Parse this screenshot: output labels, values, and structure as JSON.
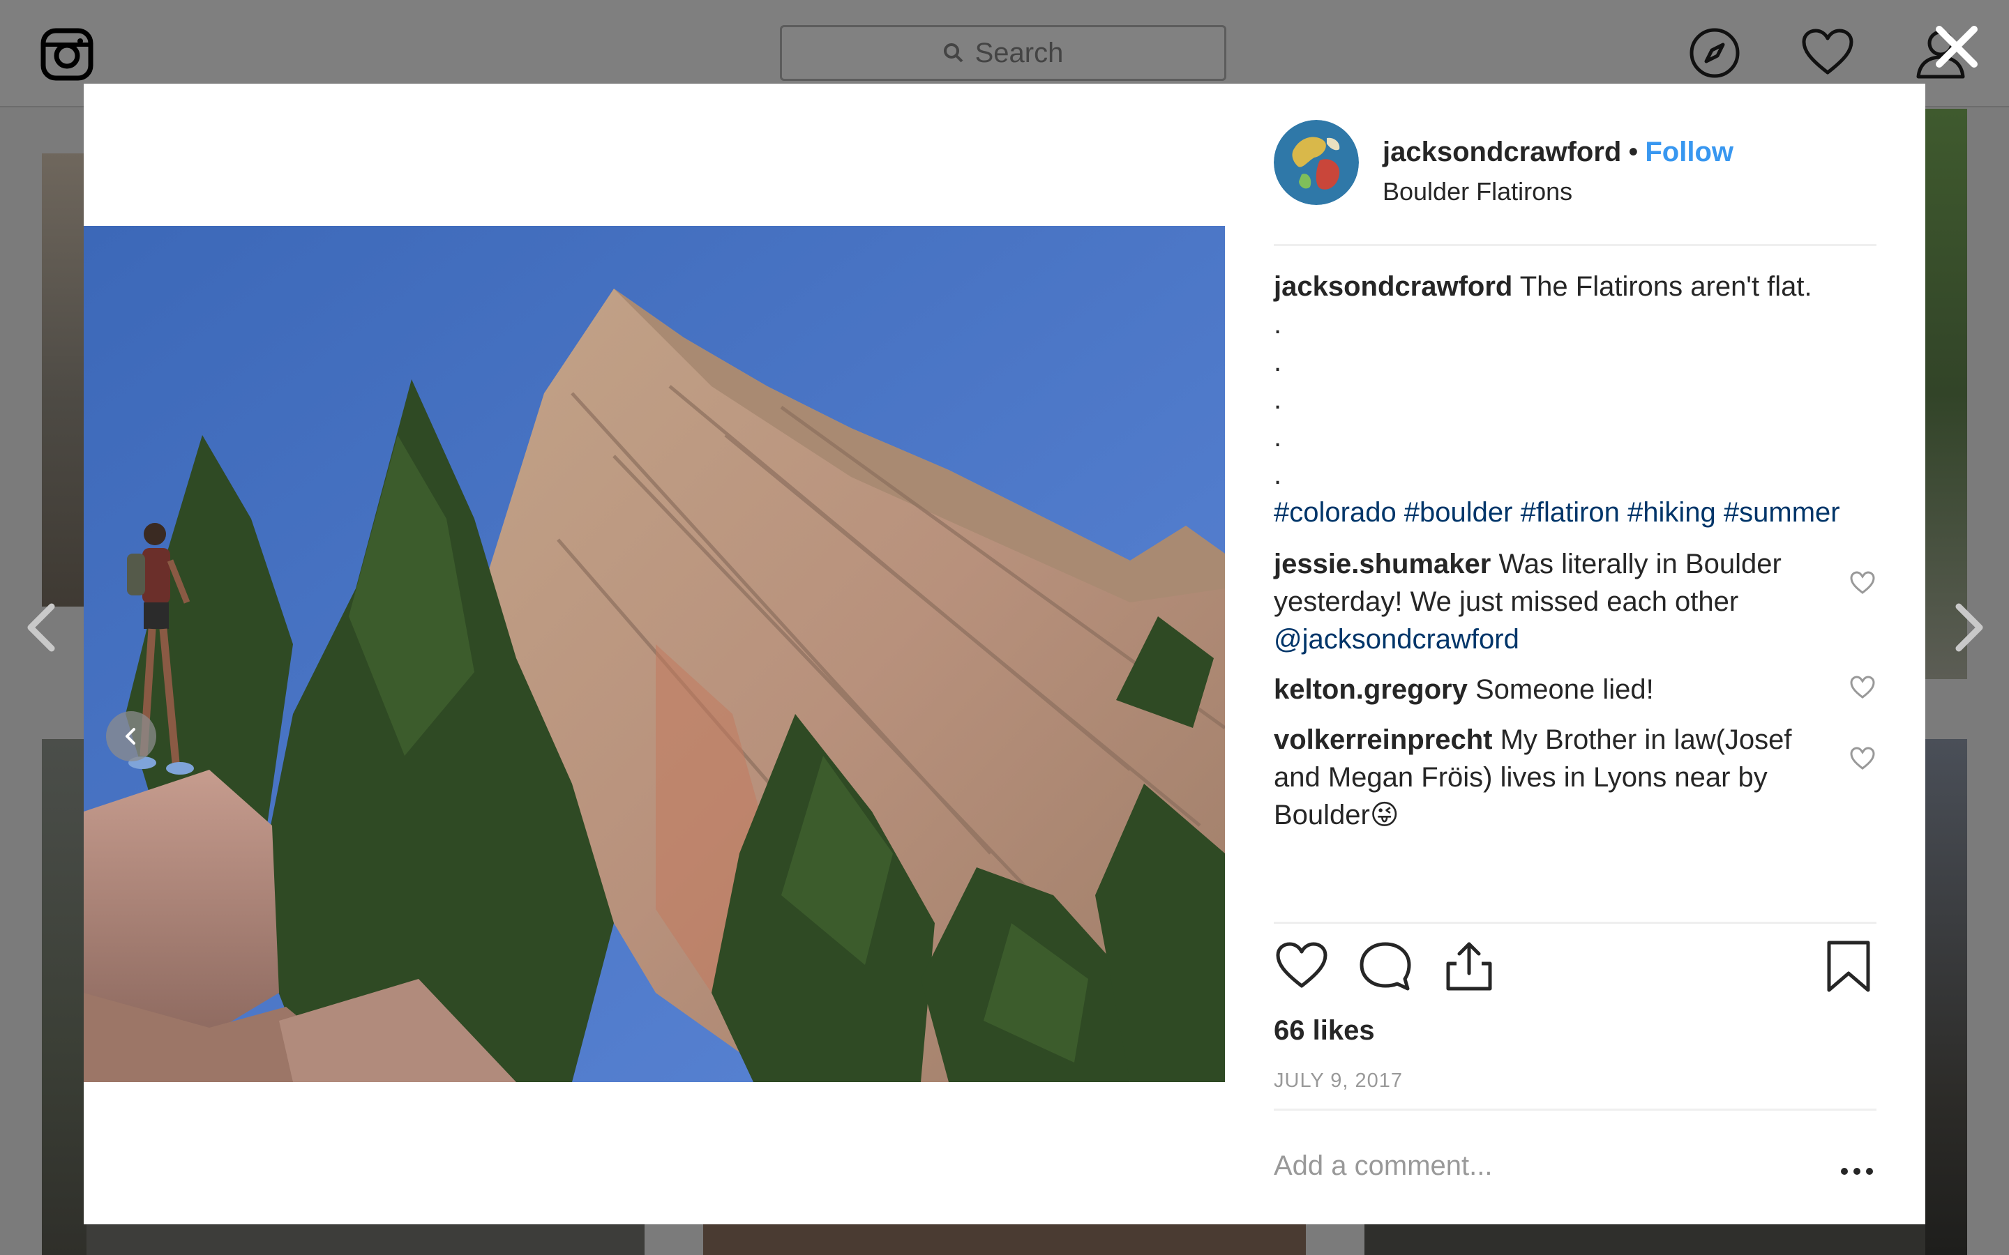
{
  "app": {
    "search_placeholder": "Search"
  },
  "post": {
    "username": "jacksondcrawford",
    "separator": "•",
    "follow_label": "Follow",
    "location": "Boulder Flatirons",
    "caption_user": "jacksondcrawford",
    "caption_text": "The Flatirons aren't flat.",
    "caption_dots": [
      ".",
      ".",
      ".",
      ".",
      "."
    ],
    "hashtags": "#colorado #boulder #flatiron #hiking #summer",
    "likes": "66 likes",
    "date": "JULY 9, 2017",
    "add_comment_placeholder": "Add a comment..."
  },
  "comments": [
    {
      "user": "jessie.shumaker",
      "text": "Was literally in Boulder yesterday! We just missed each other",
      "mention": "@jacksondcrawford"
    },
    {
      "user": "kelton.gregory",
      "text": "Someone lied!"
    },
    {
      "user": "volkerreinprecht",
      "text": "My Brother in law(Josef and Megan Fröis) lives in Lyons near by Boulder😜"
    }
  ],
  "icons": {
    "logo": "instagram-icon",
    "explore": "compass-icon",
    "activity": "heart-icon",
    "profile": "user-icon",
    "close": "close-icon",
    "like": "heart-icon",
    "comment": "speech-bubble-icon",
    "share": "share-icon",
    "save": "bookmark-icon",
    "more": "more-options-icon"
  },
  "colors": {
    "link": "#3897f0",
    "hashtag": "#003569",
    "text": "#262626",
    "muted": "#999999"
  }
}
